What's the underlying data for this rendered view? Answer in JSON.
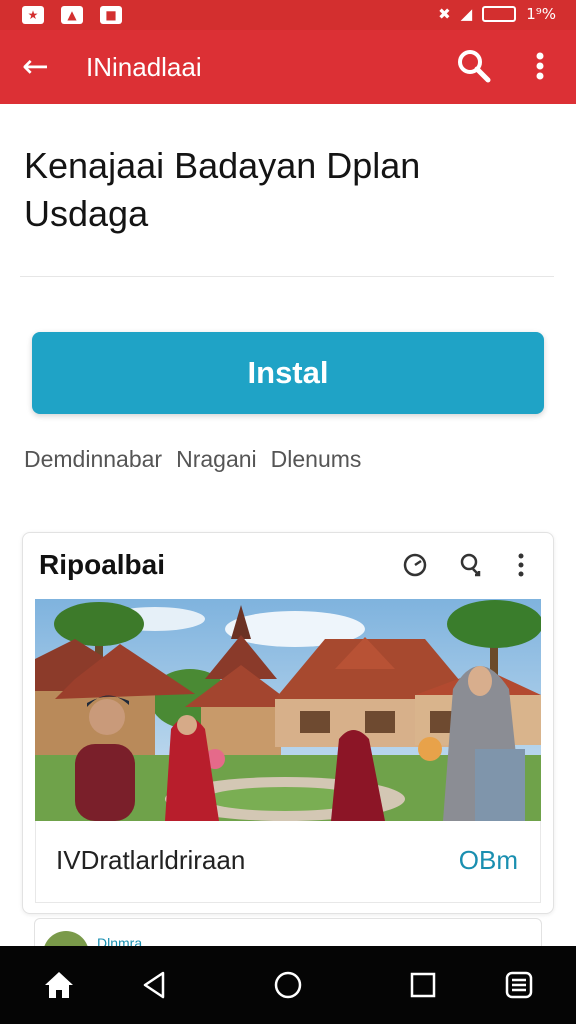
{
  "status_bar": {
    "left_icons": [
      "app-notification-icon",
      "app-notification-icon",
      "app-notification-icon"
    ],
    "right_text": "1⁹%",
    "icons": [
      "mute-icon",
      "signal-icon",
      "battery-icon"
    ]
  },
  "app_bar": {
    "title": "INinadlaai",
    "back_icon": "arrow-left-icon",
    "actions": [
      "search-icon",
      "more-vert-icon"
    ]
  },
  "page": {
    "title": "Kenajaai Badayan Dplan Usdaga",
    "install_label": "Instal",
    "meta": [
      "Demdinnabar",
      "Nragani",
      "Dlenums"
    ]
  },
  "card": {
    "title": "Ripoalbai",
    "icons": [
      "timer-icon",
      "share-icon",
      "more-vert-icon"
    ],
    "footer_text": "IVDratlarldriraan",
    "footer_action": "OBm"
  },
  "next_card": {
    "title": "Dlnmra"
  },
  "nav_bar": {
    "buttons": [
      "home-icon",
      "back-icon",
      "home-circle-icon",
      "recents-icon",
      "menu-icon"
    ]
  },
  "colors": {
    "app_bar": "#dc3035",
    "install_button": "#1fa3c6",
    "accent_text": "#1a8fb0"
  }
}
